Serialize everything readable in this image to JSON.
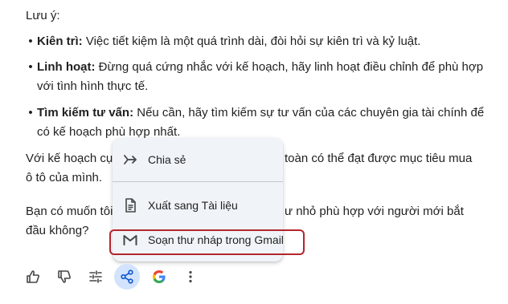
{
  "note_heading": "Lưu ý:",
  "bullets": [
    {
      "term": "Kiên trì:",
      "text": " Việc tiết kiệm là một quá trình dài, đòi hỏi sự kiên trì và kỷ luật.",
      "text2": ""
    },
    {
      "term": "Linh hoạt:",
      "text": " Đừng quá cứng nhắc với kế hoạch, hãy linh hoạt điều chỉnh để phù hợp",
      "text2": "với tình hình thực tế."
    },
    {
      "term": "Tìm kiếm tư vấn:",
      "text": " Nếu cần, hãy tìm kiếm sự tư vấn của các chuyên gia tài chính để",
      "text2": "có kế hoạch phù hợp nhất."
    }
  ],
  "para1_line1_a": "Với kế hoạch cụ",
  "para1_line1_b": "toàn có thể đạt được mục tiêu mua",
  "para1_line2": "ô tô của mình.",
  "para2_line1_a": "Bạn có muốn tôi",
  "para2_line1_b": "ư nhỏ phù hợp với người mới bắt",
  "para2_line2": "đầu không?",
  "menu": {
    "share_label": "Chia sẻ",
    "export_docs_label": "Xuất sang Tài liệu",
    "gmail_draft_label": "Soạn thư nháp trong Gmail"
  },
  "colors": {
    "highlight_border": "#b3262e",
    "menu_background": "#f0f4f9",
    "active_button_background": "#d3e3fd"
  },
  "actions": [
    "thumb-up-icon",
    "thumb-down-icon",
    "tune-icon",
    "share-icon",
    "google-icon",
    "more-vert-icon"
  ]
}
